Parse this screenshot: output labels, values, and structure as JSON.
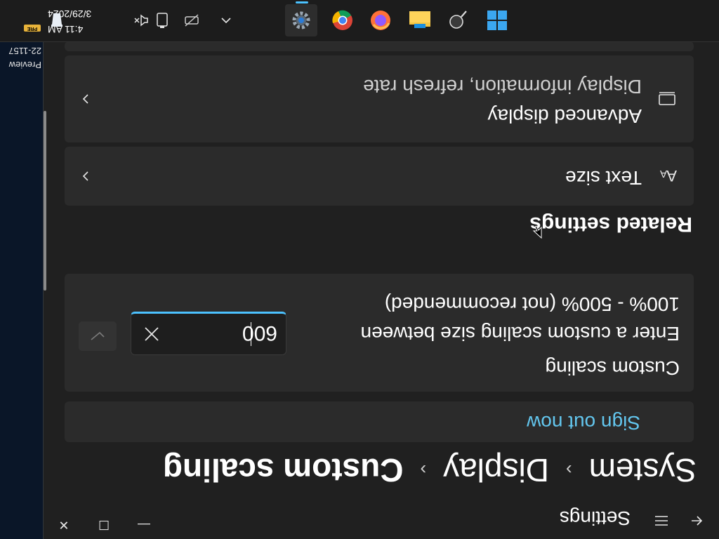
{
  "window": {
    "title": "Settings",
    "controls": {
      "minimize": "—",
      "maximize": "☐",
      "close": "✕"
    }
  },
  "breadcrumb": {
    "items": [
      "System",
      "Display"
    ],
    "separator": "›",
    "current": "Custom scaling"
  },
  "signout": {
    "link_label": "Sign out now"
  },
  "custom_scaling": {
    "title": "Custom scaling",
    "description": "Enter a custom scaling size between 100% - 500% (not recommended)",
    "input_value": "600"
  },
  "related_settings": {
    "heading": "Related settings",
    "items": [
      {
        "title": "Text size",
        "subtitle": "",
        "icon": "text-size-icon"
      },
      {
        "title": "Advanced display",
        "subtitle": "Display information, refresh rate",
        "icon": "monitor-icon"
      }
    ]
  },
  "side_window": {
    "lines": [
      "Preview",
      "22-1157"
    ]
  },
  "taskbar": {
    "apps": [
      "windows-start-icon",
      "search-icon",
      "file-explorer-icon",
      "firefox-icon",
      "chrome-icon",
      "settings-icon"
    ],
    "tray": {
      "time": "4:11 AM",
      "date": "3/29/2024",
      "badge": "PRE"
    }
  },
  "colors": {
    "accent": "#4cc2ff",
    "link": "#63c6ee",
    "window_bg": "#202020",
    "card_bg": "#2b2b2b",
    "taskbar_bg": "#1c1c1c"
  }
}
